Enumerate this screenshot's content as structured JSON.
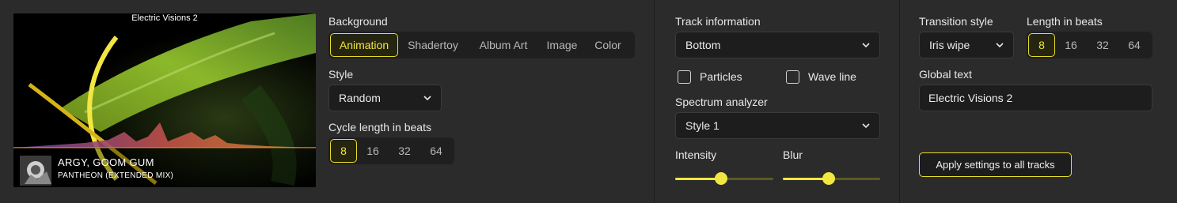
{
  "preview": {
    "title": "Electric Visions 2",
    "artist": "ARGY, GOOM GUM",
    "track": "PANTHEON (EXTENDED MIX)"
  },
  "background": {
    "label": "Background",
    "options": [
      "Animation",
      "Shadertoy",
      "Album Art",
      "Image",
      "Color"
    ],
    "selected": "Animation"
  },
  "style": {
    "label": "Style",
    "value": "Random"
  },
  "cycle": {
    "label": "Cycle length in beats",
    "options": [
      "8",
      "16",
      "32",
      "64"
    ],
    "selected": "8"
  },
  "track_info": {
    "label": "Track information",
    "value": "Bottom"
  },
  "particles": {
    "label": "Particles",
    "checked": false
  },
  "wave_line": {
    "label": "Wave line",
    "checked": false
  },
  "spectrum": {
    "label": "Spectrum analyzer",
    "value": "Style 1"
  },
  "intensity": {
    "label": "Intensity",
    "value": 0.47
  },
  "blur": {
    "label": "Blur",
    "value": 0.47
  },
  "transition": {
    "label": "Transition style",
    "value": "Iris wipe"
  },
  "length": {
    "label": "Length in beats",
    "options": [
      "8",
      "16",
      "32",
      "64"
    ],
    "selected": "8"
  },
  "global_text": {
    "label": "Global text",
    "value": "Electric Visions 2"
  },
  "apply_button": "Apply settings to all tracks",
  "colors": {
    "accent": "#f2e640",
    "panel": "#2b2b2b",
    "control": "#1d1d1d"
  }
}
